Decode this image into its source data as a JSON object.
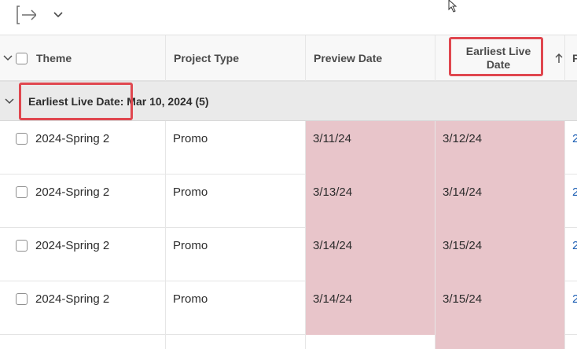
{
  "toolbar": {
    "export_icon": "export-arrow-icon",
    "dropdown_icon": "chevron-down-icon"
  },
  "columns": {
    "theme": "Theme",
    "project_type": "Project Type",
    "preview_date": "Preview Date",
    "earliest_live_date": "Earliest Live Date",
    "next_col_partial": "P",
    "sort_icon": "sort-ascending-icon"
  },
  "group": {
    "label": "Earliest Live Date:",
    "value": "Mar 10, 2024 (5)"
  },
  "rows": [
    {
      "theme": "2024-Spring 2",
      "project_type": "Promo",
      "preview_date": "3/11/24",
      "earliest_live_date": "3/12/24",
      "next_partial": "2"
    },
    {
      "theme": "2024-Spring 2",
      "project_type": "Promo",
      "preview_date": "3/13/24",
      "earliest_live_date": "3/14/24",
      "next_partial": "2"
    },
    {
      "theme": "2024-Spring 2",
      "project_type": "Promo",
      "preview_date": "3/14/24",
      "earliest_live_date": "3/15/24",
      "next_partial": "2"
    },
    {
      "theme": "2024-Spring 2",
      "project_type": "Promo",
      "preview_date": "3/14/24",
      "earliest_live_date": "3/15/24",
      "next_partial": "2"
    }
  ],
  "colors": {
    "overdue_highlight": "#e8c5ca",
    "annotation_red": "#e0474f",
    "link_blue": "#1d5fb4"
  }
}
